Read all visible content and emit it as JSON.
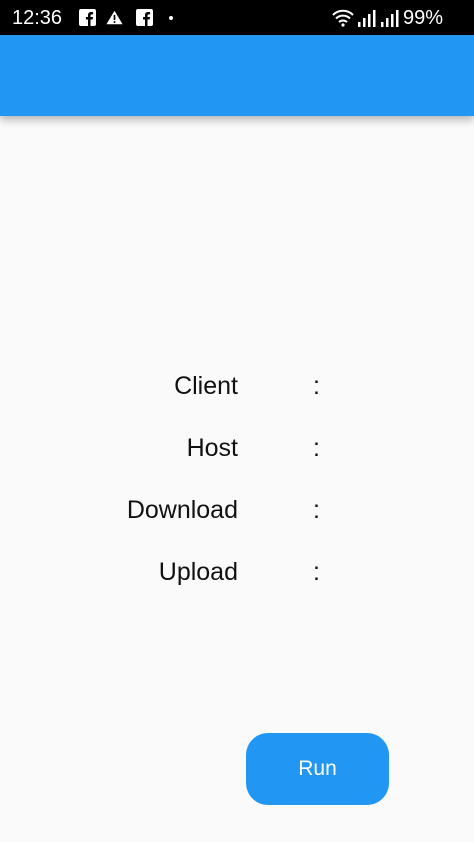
{
  "status_bar": {
    "time": "12:36",
    "battery": "99%",
    "icons": [
      "facebook-icon",
      "warning-icon",
      "facebook-icon",
      "notification-dot-icon",
      "wifi-icon",
      "signal-icon",
      "signal-icon"
    ]
  },
  "app_bar": {
    "color": "#2196f3"
  },
  "info": {
    "rows": [
      {
        "label": "Client",
        "separator": ":",
        "value": ""
      },
      {
        "label": "Host",
        "separator": ":",
        "value": ""
      },
      {
        "label": "Download",
        "separator": ":",
        "value": ""
      },
      {
        "label": "Upload",
        "separator": ":",
        "value": ""
      }
    ]
  },
  "run_button": {
    "label": "Run",
    "color": "#2196f3"
  }
}
